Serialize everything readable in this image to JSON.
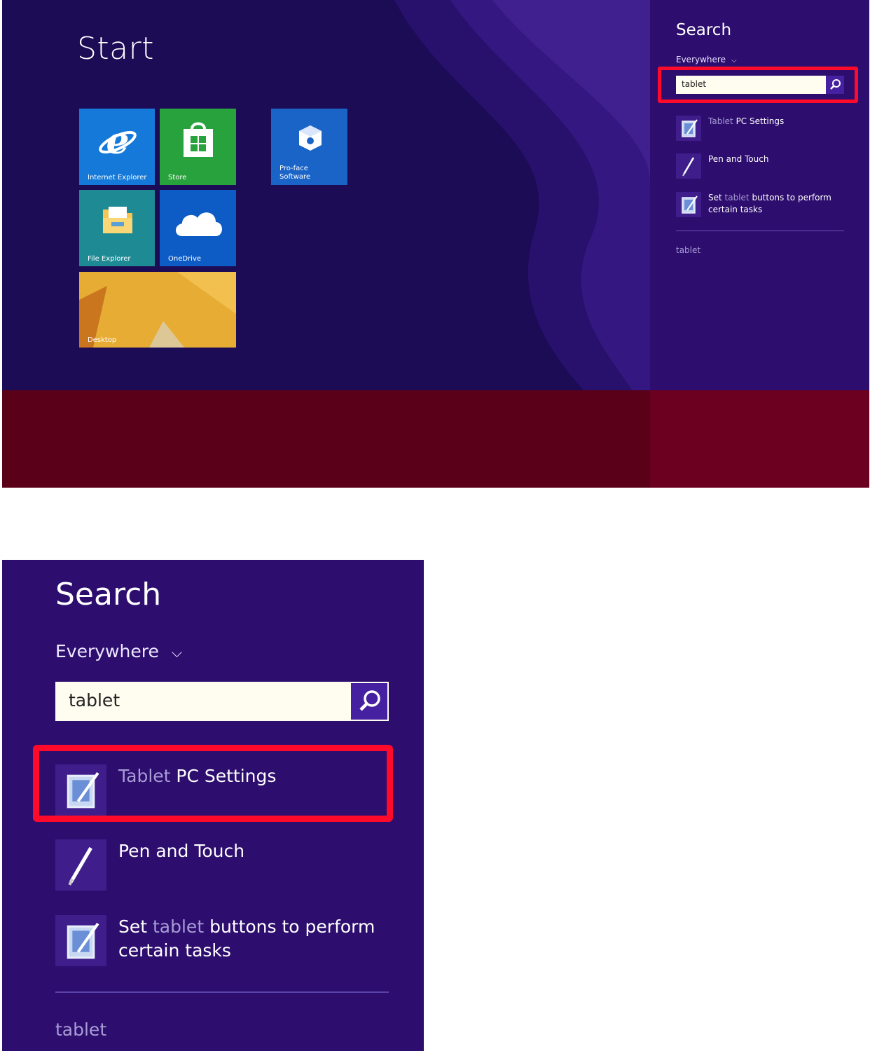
{
  "start_screen": {
    "title": "Start",
    "tiles": [
      {
        "id": "ie",
        "label": "Internet Explorer",
        "color": "#1479d8",
        "icon": "internet-explorer-icon"
      },
      {
        "id": "store",
        "label": "Store",
        "color": "#28a23c",
        "icon": "store-icon"
      },
      {
        "id": "proface",
        "label": "Pro-face\nSoftware",
        "color": "#1a64c8",
        "icon": "proface-icon"
      },
      {
        "id": "explorer",
        "label": "File Explorer",
        "color": "#1d8a94",
        "icon": "folder-icon"
      },
      {
        "id": "onedrive",
        "label": "OneDrive",
        "color": "#0d5cc6",
        "icon": "cloud-icon"
      },
      {
        "id": "desktop",
        "label": "Desktop",
        "color": "#e0a22a",
        "icon": "desktop-wallpaper"
      }
    ]
  },
  "search_charm": {
    "title": "Search",
    "scope": "Everywhere",
    "query": "tablet",
    "results": [
      {
        "parts": [
          {
            "text": "Tablet",
            "dim": true
          },
          {
            "text": " PC Settings",
            "dim": false
          }
        ],
        "icon": "tablet-pc-settings-icon"
      },
      {
        "parts": [
          {
            "text": "Pen and Touch",
            "dim": false
          }
        ],
        "icon": "pen-icon"
      },
      {
        "parts": [
          {
            "text": "Set ",
            "dim": false
          },
          {
            "text": "tablet",
            "dim": true
          },
          {
            "text": " buttons to perform certain tasks",
            "dim": false
          }
        ],
        "icon": "tablet-buttons-icon"
      }
    ],
    "footer_suggestion": "tablet"
  },
  "zoomed_search": {
    "title": "Search",
    "scope": "Everywhere",
    "query": "tablet",
    "results": [
      {
        "parts": [
          {
            "text": "Tablet",
            "dim": true
          },
          {
            "text": " PC Settings",
            "dim": false
          }
        ],
        "icon": "tablet-pc-settings-icon"
      },
      {
        "parts": [
          {
            "text": "Pen and Touch",
            "dim": false
          }
        ],
        "icon": "pen-icon"
      },
      {
        "parts": [
          {
            "text": "Set ",
            "dim": false
          },
          {
            "text": "tablet",
            "dim": true
          },
          {
            "text": " buttons to perform certain tasks",
            "dim": false
          }
        ],
        "icon": "tablet-buttons-icon"
      }
    ],
    "footer_suggestion": "tablet"
  },
  "colors": {
    "start_bg": "#1c0b55",
    "charm_bg": "#2d0d6e",
    "highlight": "#ff0a2a",
    "taskbar": "#5a0018"
  }
}
